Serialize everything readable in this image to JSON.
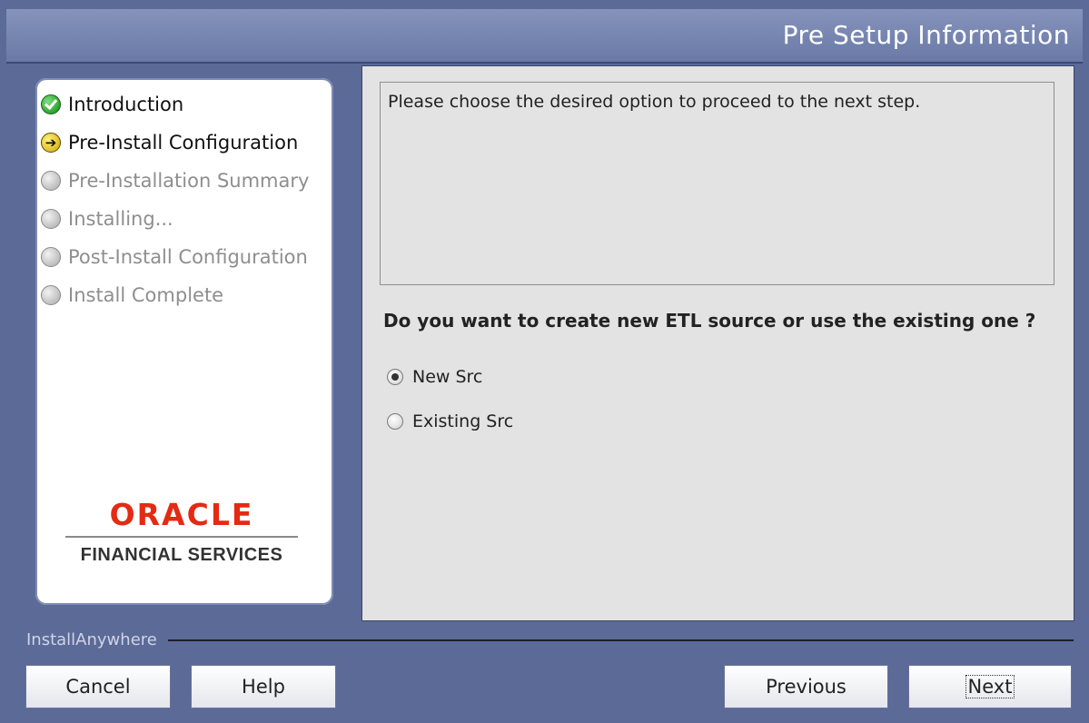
{
  "header": {
    "title": "Pre Setup Information"
  },
  "steps": [
    {
      "label": "Introduction",
      "state": "done"
    },
    {
      "label": "Pre-Install Configuration",
      "state": "current"
    },
    {
      "label": "Pre-Installation Summary",
      "state": "pending"
    },
    {
      "label": "Installing...",
      "state": "pending"
    },
    {
      "label": "Post-Install Configuration",
      "state": "pending"
    },
    {
      "label": "Install Complete",
      "state": "pending"
    }
  ],
  "logo": {
    "brand": "ORACLE",
    "sub": "FINANCIAL SERVICES"
  },
  "content": {
    "info_text": "Please choose the desired option to proceed to the next step.",
    "question": "Do you want to create new ETL source or use the existing one ?",
    "options": [
      {
        "label": "New Src",
        "selected": true
      },
      {
        "label": "Existing Src",
        "selected": false
      }
    ]
  },
  "footer": {
    "brand": "InstallAnywhere",
    "cancel_label": "Cancel",
    "help_label": "Help",
    "previous_label": "Previous",
    "next_label": "Next"
  }
}
